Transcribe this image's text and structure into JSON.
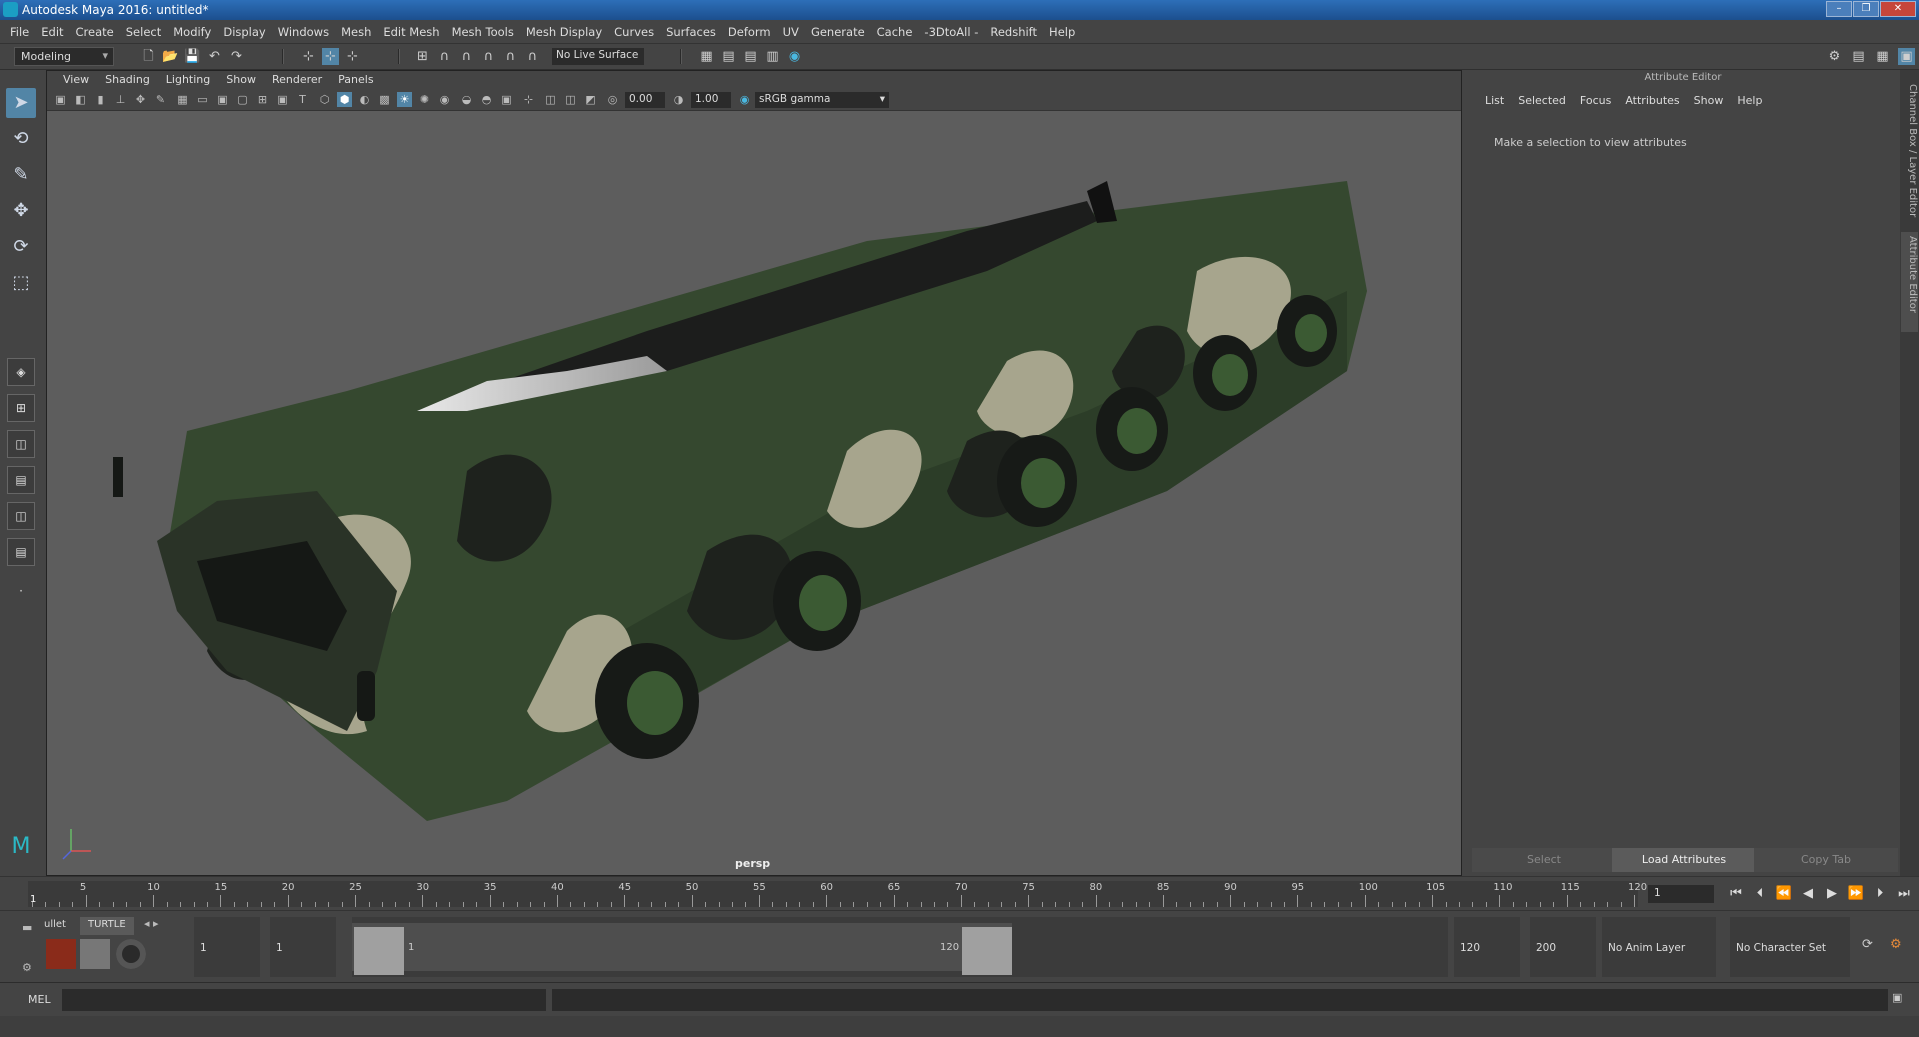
{
  "window": {
    "title": "Autodesk Maya 2016: untitled*"
  },
  "menubar": [
    "File",
    "Edit",
    "Create",
    "Select",
    "Modify",
    "Display",
    "Windows",
    "Mesh",
    "Edit Mesh",
    "Mesh Tools",
    "Mesh Display",
    "Curves",
    "Surfaces",
    "Deform",
    "UV",
    "Generate",
    "Cache",
    "-3DtoAll -",
    "Redshift",
    "Help"
  ],
  "statusline": {
    "menuset": "Modeling",
    "live_surface": "No Live Surface"
  },
  "viewport": {
    "menu": [
      "View",
      "Shading",
      "Lighting",
      "Show",
      "Renderer",
      "Panels"
    ],
    "exposure": "0.00",
    "gamma": "1.00",
    "color_space": "sRGB gamma",
    "camera": "persp"
  },
  "attribute_editor": {
    "title": "Attribute Editor",
    "menu": [
      "List",
      "Selected",
      "Focus",
      "Attributes",
      "Show",
      "Help"
    ],
    "message": "Make a selection to view attributes",
    "buttons": {
      "select": "Select",
      "load": "Load Attributes",
      "copy": "Copy Tab"
    }
  },
  "side_tabs": {
    "channel_box": "Channel Box / Layer Editor",
    "attribute_editor": "Attribute Editor"
  },
  "timeline": {
    "ticks": [
      5,
      10,
      15,
      20,
      25,
      30,
      35,
      40,
      45,
      50,
      55,
      60,
      65,
      70,
      75,
      80,
      85,
      90,
      95,
      100,
      105,
      110,
      115,
      120
    ],
    "start_marker": "1",
    "current_frame": "1",
    "range_min": 1,
    "range_max": 120
  },
  "range_slider": {
    "start_time": "1",
    "playback_start": "1",
    "slider_start_label": "1",
    "slider_end_label": "120",
    "playback_end": "120",
    "end_time": "200",
    "anim_layer": "No Anim Layer",
    "character_set": "No Character Set"
  },
  "shelf_tabs": [
    "ullet",
    "TURTLE"
  ],
  "command_line": {
    "label": "MEL"
  }
}
